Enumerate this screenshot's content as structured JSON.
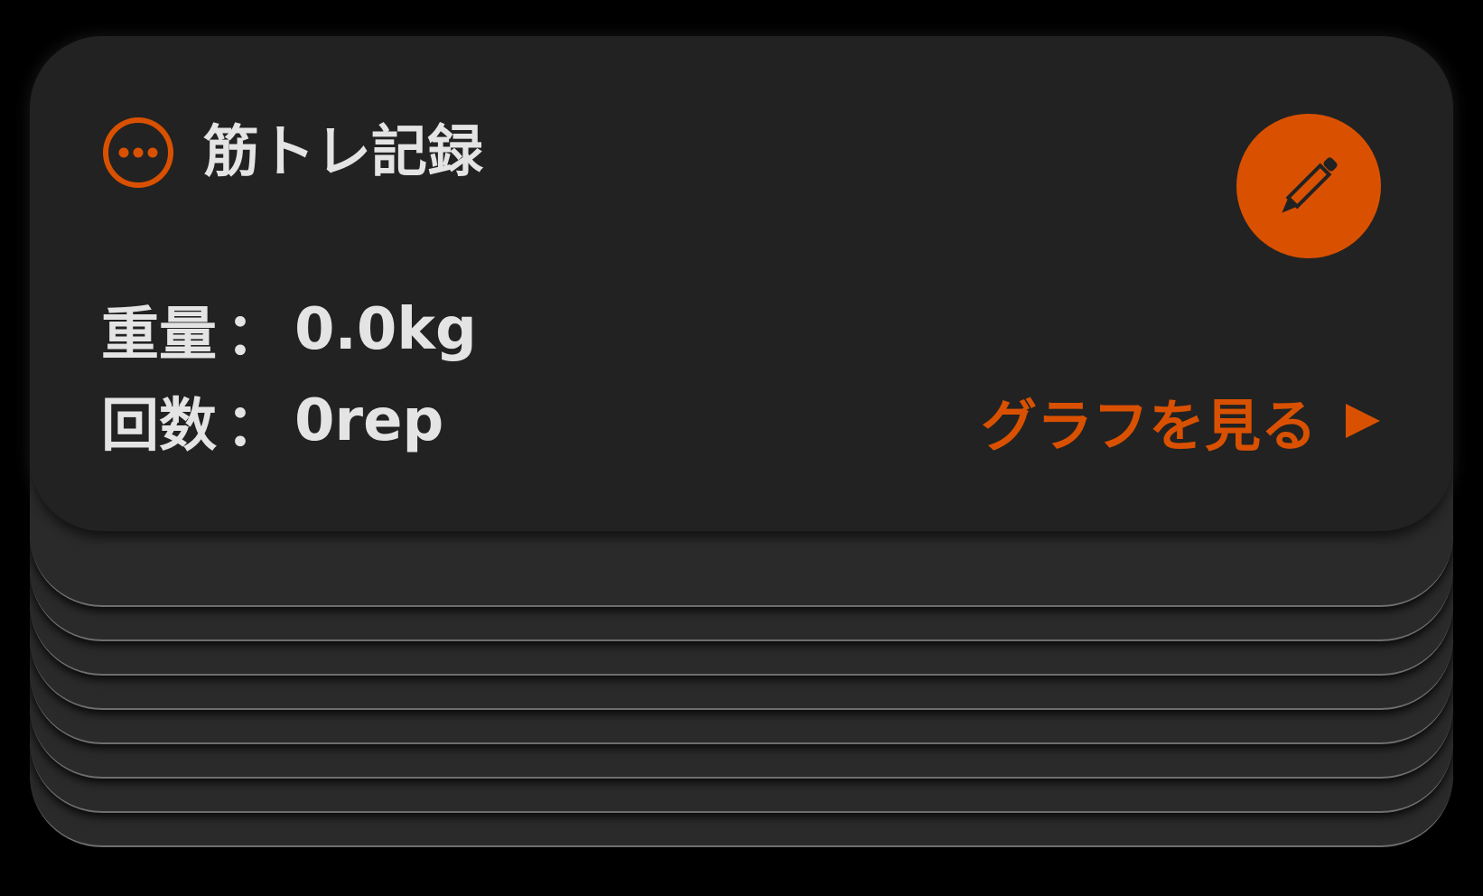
{
  "card": {
    "title": "筋トレ記録",
    "weight_label": "重量",
    "weight_value": "0.0kg",
    "reps_label": "回数",
    "reps_value": "0rep",
    "separator": "：",
    "graph_link": "グラフを見る"
  },
  "icons": {
    "more": "more-horizontal-circle-icon",
    "edit": "pencil-icon",
    "graph_arrow": "play-triangle-icon"
  },
  "colors": {
    "accent": "#d95100",
    "card_background": "#222222",
    "text": "#e4e4e4",
    "page_background": "#000000"
  },
  "stacked_record_count": 8
}
